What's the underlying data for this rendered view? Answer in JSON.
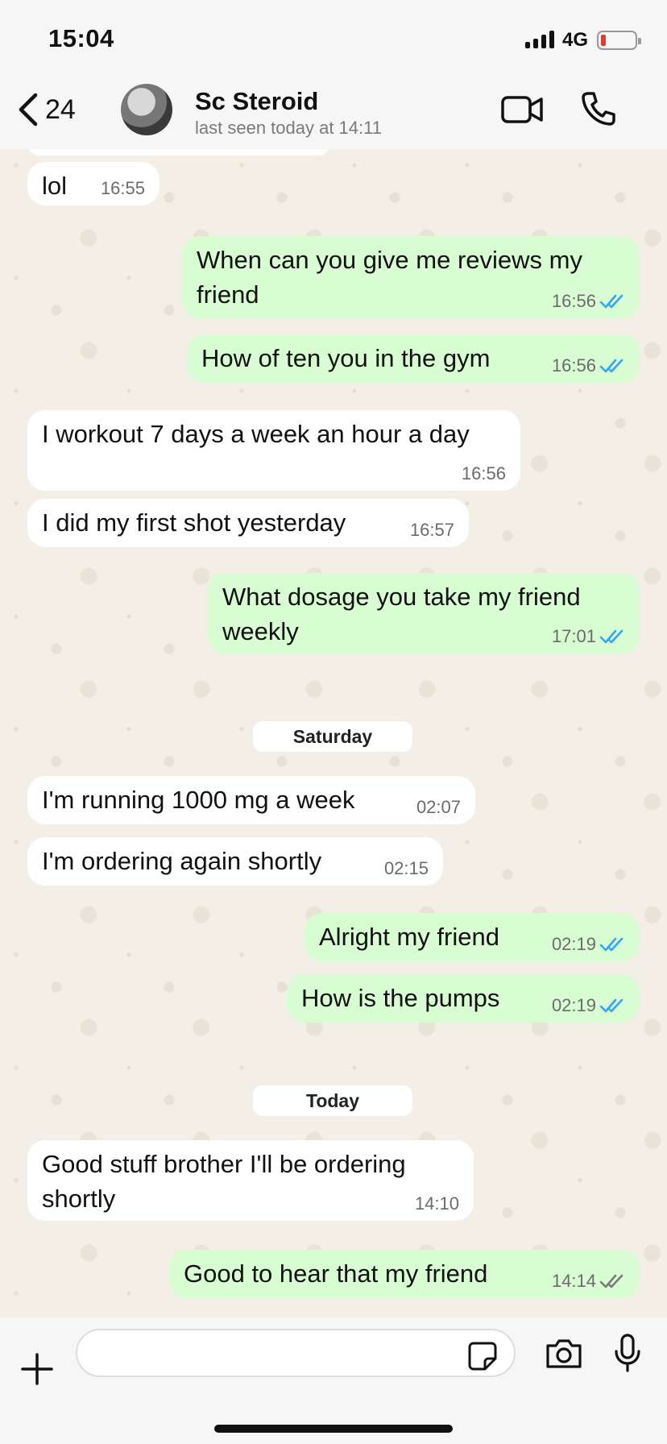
{
  "status_bar": {
    "time": "15:04",
    "network": "4G",
    "battery_color": "#e53935"
  },
  "header": {
    "back_count": "24",
    "contact_name": "Sc   Steroid",
    "last_seen": "last seen today at 14:11"
  },
  "messages": [
    {
      "dir": "in",
      "text": "lol",
      "time": "16:55",
      "ticks": ""
    },
    {
      "dir": "out",
      "text": "When can you give me reviews my friend",
      "time": "16:56",
      "ticks": "read"
    },
    {
      "dir": "out",
      "text": "How of ten you in the gym",
      "time": "16:56",
      "ticks": "read"
    },
    {
      "dir": "in",
      "text": "I workout 7 days a week an hour a day",
      "time": "16:56",
      "ticks": ""
    },
    {
      "dir": "in",
      "text": "I did my first shot yesterday",
      "time": "16:57",
      "ticks": ""
    },
    {
      "dir": "out",
      "text": "What dosage you take my friend weekly",
      "time": "17:01",
      "ticks": "read"
    },
    {
      "dir": "in",
      "text": "I'm running 1000 mg a week",
      "time": "02:07",
      "ticks": ""
    },
    {
      "dir": "in",
      "text": "I'm ordering again shortly",
      "time": "02:15",
      "ticks": ""
    },
    {
      "dir": "out",
      "text": "Alright my friend",
      "time": "02:19",
      "ticks": "read"
    },
    {
      "dir": "out",
      "text": "How is the pumps",
      "time": "02:19",
      "ticks": "read"
    },
    {
      "dir": "in",
      "text": "Good stuff brother I'll be ordering shortly",
      "time": "14:10",
      "ticks": ""
    },
    {
      "dir": "out",
      "text": "Good to hear that my friend",
      "time": "14:14",
      "ticks": "delivered"
    }
  ],
  "day_separators": {
    "saturday": "Saturday",
    "today": "Today"
  },
  "colors": {
    "incoming": "#ffffff",
    "outgoing": "#d9fdd3",
    "read_tick": "#34a6f4",
    "delivered_tick": "#7a7a7a"
  },
  "input": {
    "placeholder": ""
  }
}
